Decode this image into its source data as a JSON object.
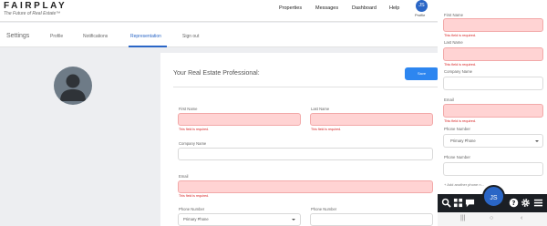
{
  "brand": {
    "name": "FAIRPLAY",
    "tagline": "The Future of Real Estate™"
  },
  "top_nav": {
    "items": [
      "Properties",
      "Messages",
      "Dashboard",
      "Help"
    ],
    "user_initials": "JS",
    "user_name": "Profile"
  },
  "settings": {
    "title": "Settings",
    "tabs": [
      {
        "label": "Profile",
        "active": false
      },
      {
        "label": "Notifications",
        "active": false
      },
      {
        "label": "Representation",
        "active": true
      },
      {
        "label": "Sign out",
        "active": false
      }
    ]
  },
  "form": {
    "heading": "Your Real Estate Professional:",
    "save_label": "Save",
    "required_error": "This field is required.",
    "fields": {
      "first_name": {
        "label": "First Name",
        "value": ""
      },
      "last_name": {
        "label": "Last Name",
        "value": ""
      },
      "company_name": {
        "label": "Company Name",
        "value": ""
      },
      "email": {
        "label": "Email",
        "value": ""
      },
      "phone_number_type": {
        "label": "Phone Number",
        "value": "Primary Phone"
      },
      "phone_number": {
        "label": "Phone Number",
        "value": ""
      }
    }
  },
  "mobile": {
    "first_name_label": "First Name",
    "last_name_label": "Last Name",
    "company_name_label": "Company Name",
    "email_label": "Email",
    "phone_type_label": "Phone Number",
    "phone_type_value": "Primary Phone",
    "phone_number_label": "Phone Number",
    "add_phone_label": "+ Add another phone n...",
    "required_error": "This field is required.",
    "fab_initials": "JS",
    "toolbar_icons": [
      "search-icon",
      "grid-icon",
      "chat-icon",
      "help-icon",
      "settings-icon",
      "menu-icon"
    ],
    "system_nav": [
      "|||",
      "○",
      "‹"
    ]
  },
  "colors": {
    "accent": "#2a66c6",
    "save_button": "#2d86f0",
    "error_fill": "#ffd3d3",
    "error_text": "#d62020",
    "toolbar": "#1b1f24"
  }
}
